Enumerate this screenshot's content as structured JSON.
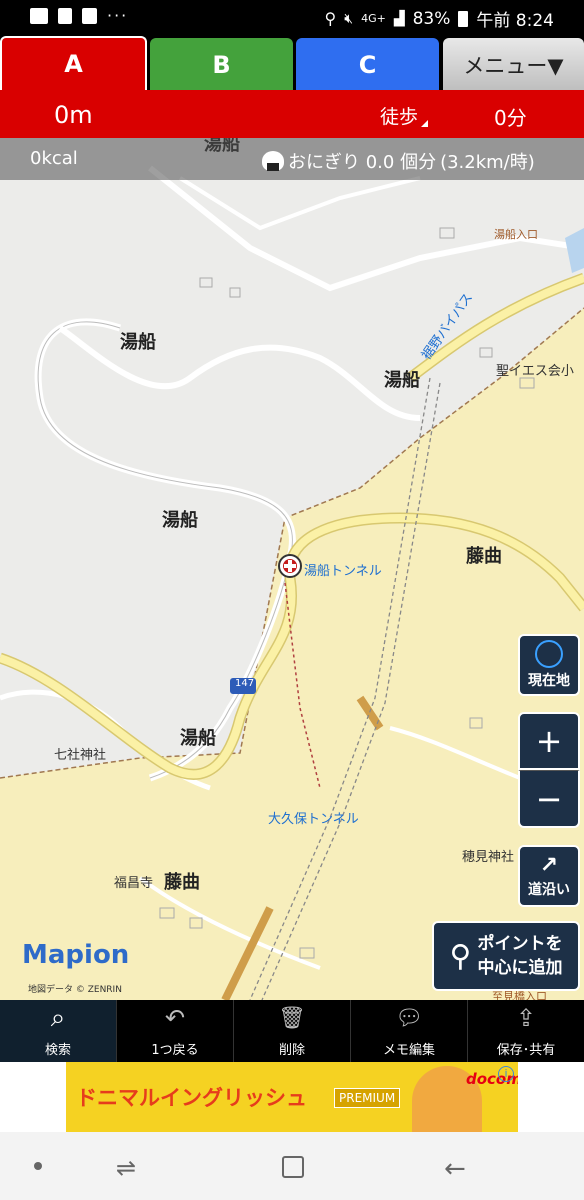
{
  "status_bar": {
    "battery": "83%",
    "time": "午前 8:24",
    "signal": "4G+",
    "dots": "···"
  },
  "tabs": [
    {
      "label": "A",
      "color": "#d90000"
    },
    {
      "label": "B",
      "color": "#44a23c"
    },
    {
      "label": "C",
      "color": "#2f6ef0"
    }
  ],
  "menu_label": "メニュー▼",
  "info": {
    "distance": "0m",
    "mode": "徒歩",
    "duration": "0分"
  },
  "calorie": {
    "kcal": "0kcal",
    "onigiri": "おにぎり 0.0 個分",
    "speed": "(3.2km/時)"
  },
  "map_labels": {
    "yubune_top": "湯船",
    "yubune_1": "湯船",
    "yubune_2": "湯船",
    "yubune_3": "湯船",
    "yubune_4": "湯船",
    "fujimagari_1": "藤曲",
    "fujimagari_2": "藤曲",
    "yubune_entrance": "湯船入口",
    "church": "聖イエス会小",
    "bypass": "裾野バイパス",
    "tunnel_yubune": "湯船トンネル",
    "tunnel_okubo": "大久保トンネル",
    "shichisha": "七社神社",
    "hozumi": "穂見神社",
    "fukushoji": "福昌寺",
    "route_number": "147",
    "bottom_partial": "至見橋入口"
  },
  "buttons": {
    "current_location": "現在地",
    "zoom_in": "+",
    "zoom_out": "−",
    "along_road": "道沿い",
    "add_point_line1": "ポイントを",
    "add_point_line2": "中心に追加"
  },
  "logo": "Mapion",
  "copyright": "地図データ © ZENRIN",
  "toolbar": [
    {
      "label": "検索",
      "icon": "search-icon"
    },
    {
      "label": "1つ戻る",
      "icon": "undo-icon"
    },
    {
      "label": "削除",
      "icon": "trash-icon"
    },
    {
      "label": "メモ編集",
      "icon": "memo-icon"
    },
    {
      "label": "保存･共有",
      "icon": "share-icon"
    }
  ],
  "ad": {
    "title": "ドニマルイングリッシュ",
    "badge": "PREMIUM",
    "brand": "docomo",
    "info": "i"
  }
}
